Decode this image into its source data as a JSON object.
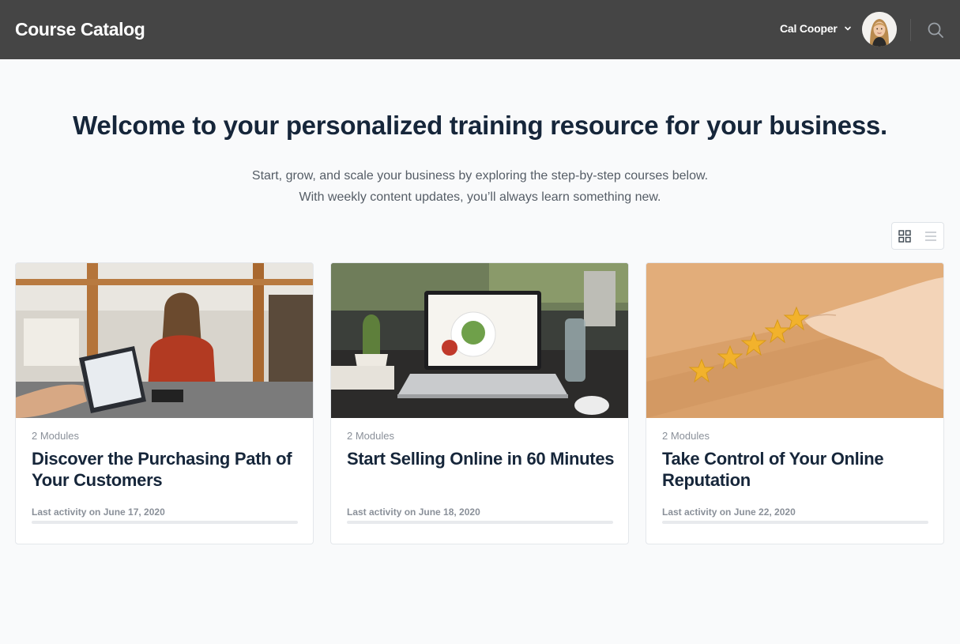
{
  "header": {
    "app_title": "Course Catalog",
    "user_name": "Cal Cooper"
  },
  "hero": {
    "title": "Welcome to your personalized training resource for your business.",
    "subtitle_line1": "Start, grow, and scale your business by exploring the step-by-step courses below.",
    "subtitle_line2": "With weekly content updates, you’ll always learn something new."
  },
  "view_toggle": {
    "active": "grid"
  },
  "courses": [
    {
      "modules": "2 Modules",
      "title": "Discover the Purchasing Path of Your Customers",
      "activity": "Last activity on June 17, 2020",
      "progress": 0
    },
    {
      "modules": "2 Modules",
      "title": "Start Selling Online in 60 Minutes",
      "activity": "Last activity on June 18, 2020",
      "progress": 0
    },
    {
      "modules": "2 Modules",
      "title": "Take Control of Your Online Reputation",
      "activity": "Last activity on June 22, 2020",
      "progress": 0
    }
  ],
  "colors": {
    "header_bg": "#454545",
    "page_bg": "#f9fafb",
    "heading": "#16263a",
    "muted": "#8a9099"
  }
}
